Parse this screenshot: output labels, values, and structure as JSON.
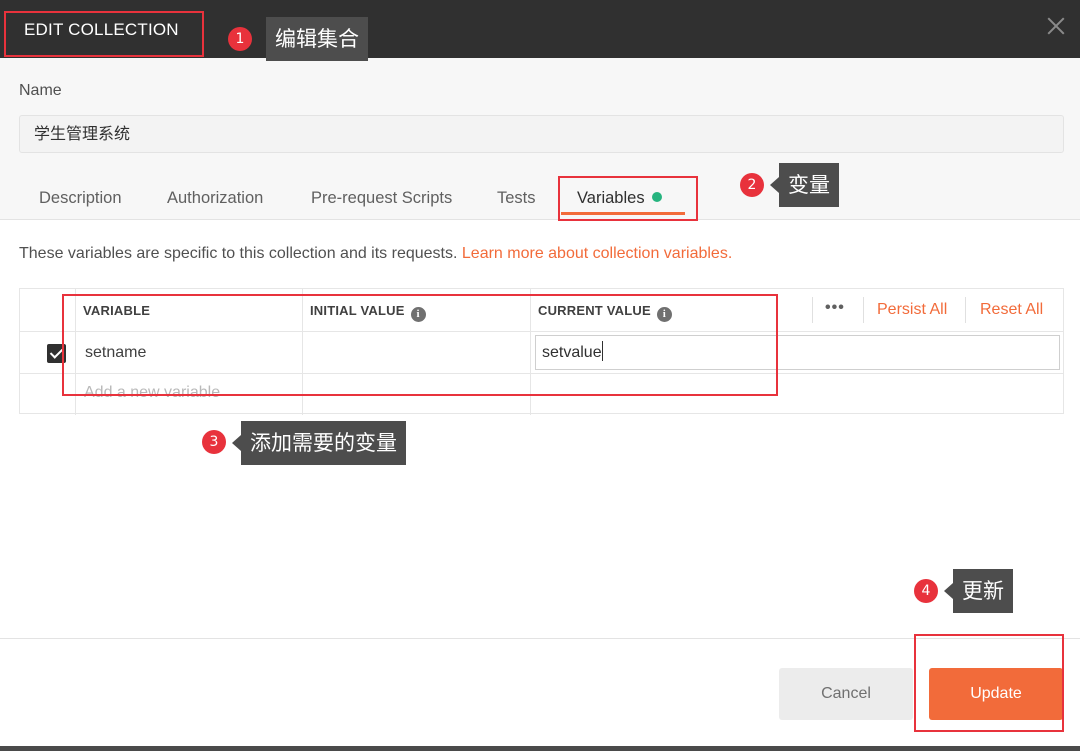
{
  "modal": {
    "title": "EDIT COLLECTION",
    "close_icon": "close-icon"
  },
  "name": {
    "label": "Name",
    "value": "学生管理系统"
  },
  "tabs": [
    {
      "label": "Description"
    },
    {
      "label": "Authorization"
    },
    {
      "label": "Pre-request Scripts"
    },
    {
      "label": "Tests"
    },
    {
      "label": "Variables",
      "active": true
    }
  ],
  "variables": {
    "description": "These variables are specific to this collection and its requests.",
    "learn_more_link": "Learn more about collection variables.",
    "columns": [
      "VARIABLE",
      "INITIAL VALUE",
      "CURRENT VALUE"
    ],
    "more_label": "•••",
    "persist_all": "Persist All",
    "reset_all": "Reset All",
    "rows": [
      {
        "checked": true,
        "variable": "setname",
        "initial_value": "",
        "current_value": "setvalue"
      }
    ],
    "add_placeholder": "Add a new variable"
  },
  "footer": {
    "cancel": "Cancel",
    "update": "Update"
  },
  "annotations": [
    {
      "number": "1",
      "text": "编辑集合"
    },
    {
      "number": "2",
      "text": "变量"
    },
    {
      "number": "3",
      "text": "添加需要的变量"
    },
    {
      "number": "4",
      "text": "更新"
    }
  ],
  "colors": {
    "accent": "#f26b3a",
    "header_bg": "#303030",
    "annotation_red": "#e8323c",
    "active_dot": "#26b47f"
  }
}
